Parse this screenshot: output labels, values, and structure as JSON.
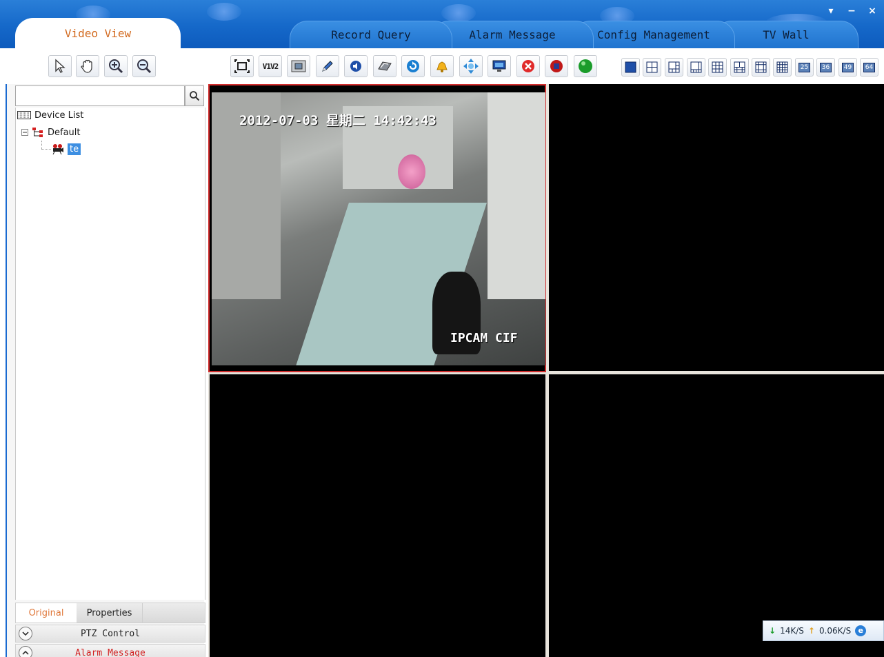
{
  "tabs": [
    {
      "label": "Video View",
      "active": true
    },
    {
      "label": "Record Query",
      "active": false
    },
    {
      "label": "Alarm Message",
      "active": false
    },
    {
      "label": "Config Management",
      "active": false
    },
    {
      "label": "TV Wall",
      "active": false
    }
  ],
  "window_buttons": {
    "menu": "▾",
    "minimize": "−",
    "close": "×"
  },
  "nav_tools": [
    "select-pointer-icon",
    "pan-hand-icon",
    "zoom-in-icon",
    "zoom-out-icon"
  ],
  "video_tools": {
    "v1v2_label": "V1V2",
    "icons": [
      "fullscreen-icon",
      "v1v2-icon",
      "snapshot-icon",
      "pen-icon",
      "audio-icon",
      "record-icon",
      "refresh-icon",
      "alarm-bell-icon",
      "ptz-direction-icon",
      "monitor-icon",
      "stop-icon",
      "stop-record-icon",
      "connect-icon"
    ]
  },
  "layouts": [
    {
      "label": ""
    },
    {
      "label": ""
    },
    {
      "label": ""
    },
    {
      "label": ""
    },
    {
      "label": ""
    },
    {
      "label": ""
    },
    {
      "label": ""
    },
    {
      "label": ""
    },
    {
      "label": "25"
    },
    {
      "label": "36"
    },
    {
      "label": "49"
    },
    {
      "label": "64"
    }
  ],
  "search": {
    "placeholder": "",
    "value": ""
  },
  "tree": {
    "root": "Device List",
    "group": "Default",
    "device": "te"
  },
  "bottom_tabs": {
    "original": "Original",
    "properties": "Properties"
  },
  "sections": {
    "ptz": "PTZ Control",
    "alarm": "Alarm Message"
  },
  "video": {
    "timestamp": "2012-07-03 星期二 14:42:43",
    "camera_label": "IPCAM CIF"
  },
  "network": {
    "download": "14K/S",
    "upload": "0.06K/S"
  },
  "colors": {
    "accent_blue": "#1568c9",
    "active_tab_text": "#d2691e",
    "selection_border": "#d22d2d",
    "alarm_text": "#d22020"
  }
}
